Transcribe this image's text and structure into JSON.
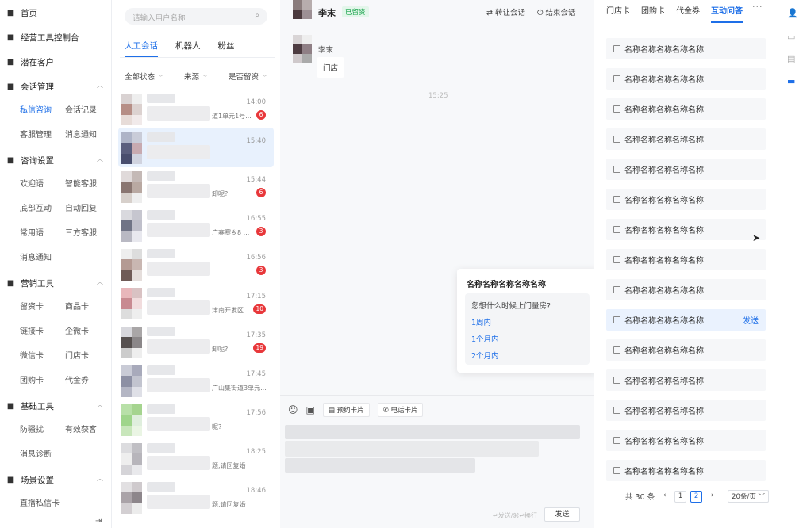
{
  "sidebar": {
    "items": [
      {
        "label": "首页",
        "icon": "home-icon"
      },
      {
        "label": "经营工具控制台",
        "icon": "dashboard-icon"
      },
      {
        "label": "潜在客户",
        "icon": "users-icon"
      }
    ],
    "groups": [
      {
        "label": "会话管理",
        "icon": "flag-icon",
        "subs": [
          "私信咨询",
          "会话记录",
          "客服管理",
          "消息通知"
        ]
      },
      {
        "label": "咨询设置",
        "icon": "user-voice-icon",
        "subs": [
          "欢迎语",
          "智能客服",
          "底部互动",
          "自动回复",
          "常用语",
          "三方客服",
          "消息通知"
        ]
      },
      {
        "label": "营销工具",
        "icon": "folder-icon",
        "subs": [
          "留资卡",
          "商品卡",
          "链接卡",
          "企微卡",
          "微信卡",
          "门店卡",
          "团购卡",
          "代金券"
        ]
      },
      {
        "label": "基础工具",
        "icon": "briefcase-icon",
        "subs": [
          "防骚扰",
          "有效获客",
          "消息诊断"
        ]
      },
      {
        "label": "场景设置",
        "icon": "settings-icon",
        "subs": [
          "直播私信卡"
        ]
      }
    ],
    "active_sub": "私信咨询"
  },
  "convlist": {
    "search_placeholder": "请输入用户名称",
    "tabs": [
      "人工会话",
      "机器人",
      "粉丝"
    ],
    "active_tab": "人工会话",
    "filters": [
      "全部状态",
      "来源",
      "是否留资"
    ],
    "items": [
      {
        "time": "14:00",
        "snippet": "道1单元1号...",
        "badge": "6"
      },
      {
        "time": "15:40",
        "snippet": "",
        "badge": ""
      },
      {
        "time": "15:44",
        "snippet": "卸呢?",
        "badge": "6"
      },
      {
        "time": "16:55",
        "snippet": "广寨赛乡8 ...",
        "badge": "3"
      },
      {
        "time": "16:56",
        "snippet": "",
        "badge": "3"
      },
      {
        "time": "17:15",
        "snippet": "津南开发区",
        "badge": "10"
      },
      {
        "time": "17:35",
        "snippet": "卸呢?",
        "badge": "19"
      },
      {
        "time": "17:45",
        "snippet": "广山集街道3单元...",
        "badge": ""
      },
      {
        "time": "17:56",
        "snippet": "呢?",
        "badge": ""
      },
      {
        "time": "18:25",
        "snippet": "题,请回复婚",
        "badge": ""
      },
      {
        "time": "18:46",
        "snippet": "题,请回复婚",
        "badge": ""
      }
    ]
  },
  "chat": {
    "user_name": "李末",
    "user_tag": "已留资",
    "transfer": "转让会话",
    "end": "结束会话",
    "msg_sender": "李末",
    "msg_text": "门店",
    "timestamp": "15:25",
    "tools": [
      "预约卡片",
      "电话卡片"
    ],
    "hint": "↵发送/⌘↵换行",
    "send": "发送"
  },
  "popover": {
    "title": "名称名称名称名称名称",
    "question": "您想什么时候上门量房?",
    "options": [
      "1周内",
      "1个月内",
      "2个月内"
    ]
  },
  "rpanel": {
    "tabs": [
      "门店卡",
      "团购卡",
      "代金券",
      "互动问答"
    ],
    "active_tab": "互动问答",
    "more": "···",
    "items": [
      "名称名称名称名称名称",
      "名称名称名称名称名称",
      "名称名称名称名称名称",
      "名称名称名称名称名称",
      "名称名称名称名称名称",
      "名称名称名称名称名称",
      "名称名称名称名称名称",
      "名称名称名称名称名称",
      "名称名称名称名称名称",
      "名称名称名称名称名称",
      "名称名称名称名称名称",
      "名称名称名称名称名称",
      "名称名称名称名称名称",
      "名称名称名称名称名称",
      "名称名称名称名称名称"
    ],
    "send_label": "发送",
    "pager": {
      "total": "共 30 条",
      "pages": [
        "1",
        "2"
      ],
      "current": "2",
      "size": "20条/页"
    }
  },
  "colors": {
    "accent": "#1e6fe8",
    "badge": "#e8373a",
    "tag_green": "#17a34a"
  }
}
